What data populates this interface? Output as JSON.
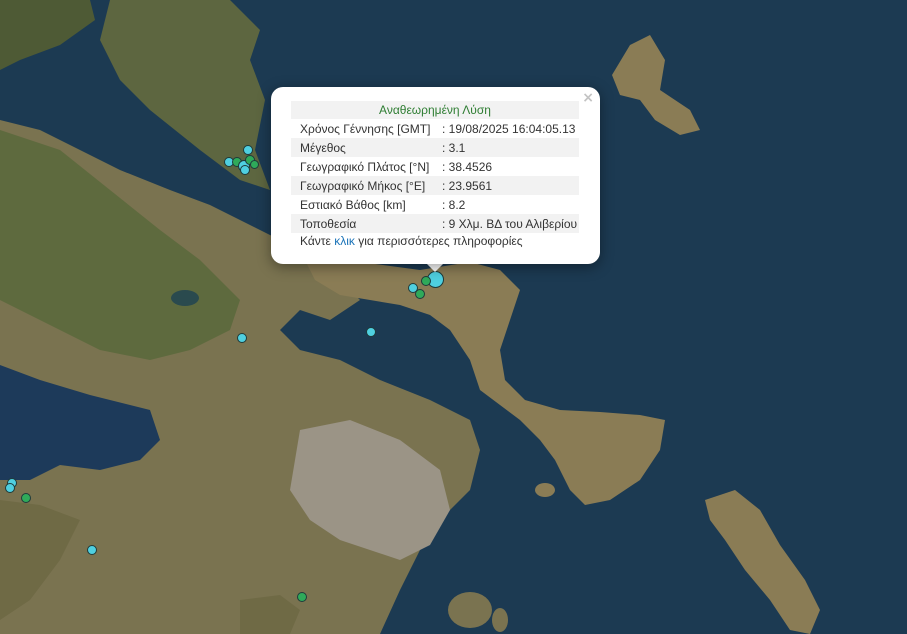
{
  "popup": {
    "title": "Αναθεωρημένη Λύση",
    "close_glyph": "×",
    "rows": [
      {
        "label": "Χρόνος Γέννησης [GMT]",
        "value": ": 19/08/2025 16:04:05.13"
      },
      {
        "label": "Μέγεθος",
        "value": ": 3.1"
      },
      {
        "label": "Γεωγραφικό Πλάτος [°N]",
        "value": ": 38.4526"
      },
      {
        "label": "Γεωγραφικό Μήκος [°E]",
        "value": ": 23.9561"
      },
      {
        "label": "Εστιακό Βάθος [km]",
        "value": ": 8.2"
      },
      {
        "label": "Τοποθεσία",
        "value": ": 9 Χλμ. ΒΔ του Αλιβερίου"
      }
    ],
    "more_prefix": "Κάντε ",
    "more_link": "κλικ",
    "more_suffix": " για περισσότερες πληροφορίες"
  },
  "colors": {
    "sea": "#1c3a52",
    "land": "#6e6a45",
    "quake_recent": "#4fd0e0",
    "quake_older": "#2faa5a",
    "title_green": "#2e7d32",
    "link": "#1a73b8"
  }
}
